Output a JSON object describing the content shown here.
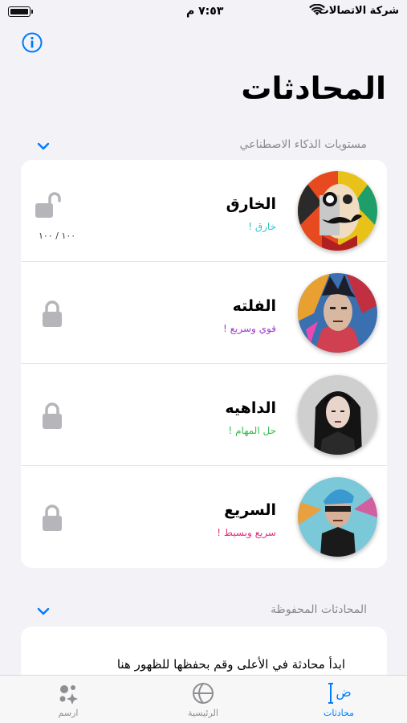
{
  "status_bar": {
    "carrier": "شركة الاتصالات",
    "time": "٧:٥٣ م"
  },
  "page_title": "المحادثات",
  "ai_levels": {
    "section_label": "مستويات الذكاء الاصطناعي",
    "items": [
      {
        "name": "الخارق",
        "subtitle": "خارق !",
        "subtitle_color": "#2ec4c4",
        "locked": false,
        "usage": "١٠٠ / ١٠٠"
      },
      {
        "name": "الفلته",
        "subtitle": "قوي وسريع !",
        "subtitle_color": "#a03cc8",
        "locked": true
      },
      {
        "name": "الداهيه",
        "subtitle": "حل المهام !",
        "subtitle_color": "#2ebd4a",
        "locked": true
      },
      {
        "name": "السريع",
        "subtitle": "سريع وبسيط !",
        "subtitle_color": "#e0307a",
        "locked": true
      }
    ]
  },
  "saved": {
    "section_label": "المحادثات المحفوظة",
    "empty_message": "ابدأ محادثة في الأعلى وقم بحفظها للظهور هنا"
  },
  "tabs": [
    {
      "label": "محادثات",
      "icon": "chat-text-icon",
      "active": true
    },
    {
      "label": "الرئيسية",
      "icon": "globe-icon",
      "active": false
    },
    {
      "label": "ارسم",
      "icon": "sparkles-icon",
      "active": false
    }
  ],
  "colors": {
    "accent": "#007aff",
    "background": "#f2f2f7"
  }
}
